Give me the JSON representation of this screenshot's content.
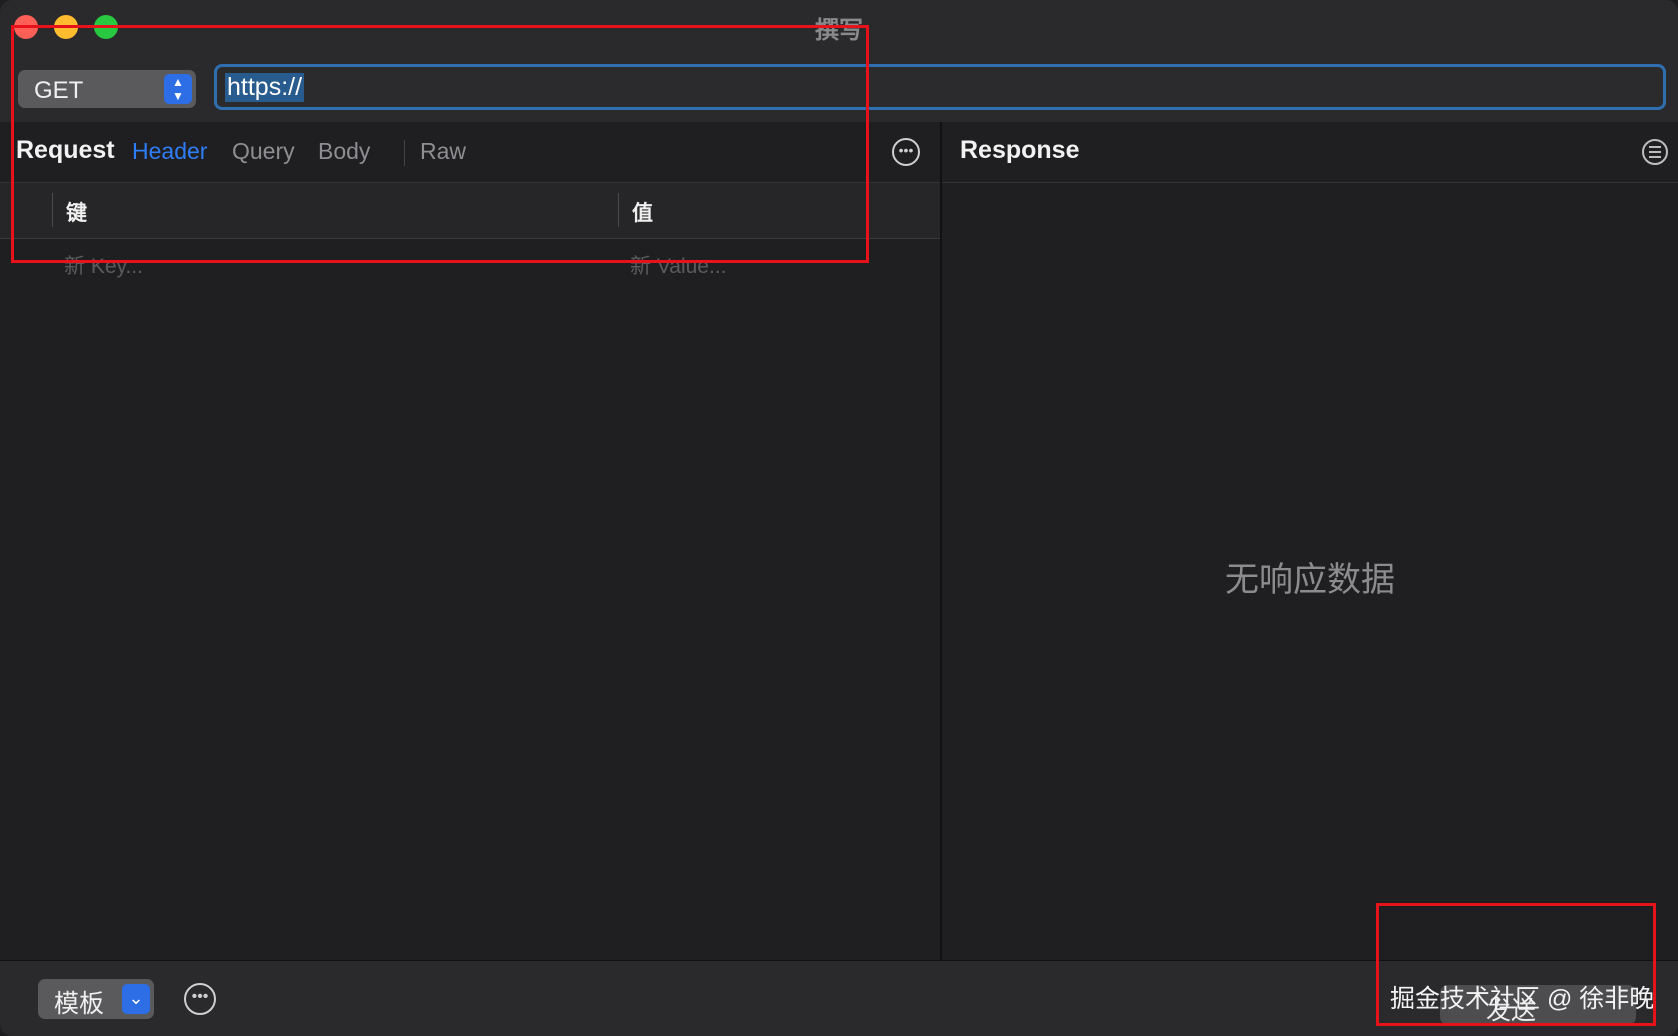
{
  "window": {
    "title": "撰写"
  },
  "toolbar": {
    "method": "GET",
    "url": "https://"
  },
  "request": {
    "title": "Request",
    "tabs": [
      "Header",
      "Query",
      "Body",
      "Raw"
    ],
    "active_tab": "Header",
    "columns": {
      "key": "键",
      "value": "值"
    },
    "placeholder_key": "新 Key...",
    "placeholder_value": "新 Value..."
  },
  "response": {
    "title": "Response",
    "empty_text": "无响应数据"
  },
  "bottom": {
    "template_label": "模板",
    "send_label": "发送",
    "watermark": "掘金技术社区 @ 徐非晚"
  },
  "colors": {
    "accent": "#2f7df6",
    "annotation": "#e8131a"
  },
  "icons": [
    "close-icon",
    "minimize-icon",
    "maximize-icon",
    "stepper-icon",
    "more-icon",
    "filter-icon",
    "chevron-down-icon"
  ]
}
